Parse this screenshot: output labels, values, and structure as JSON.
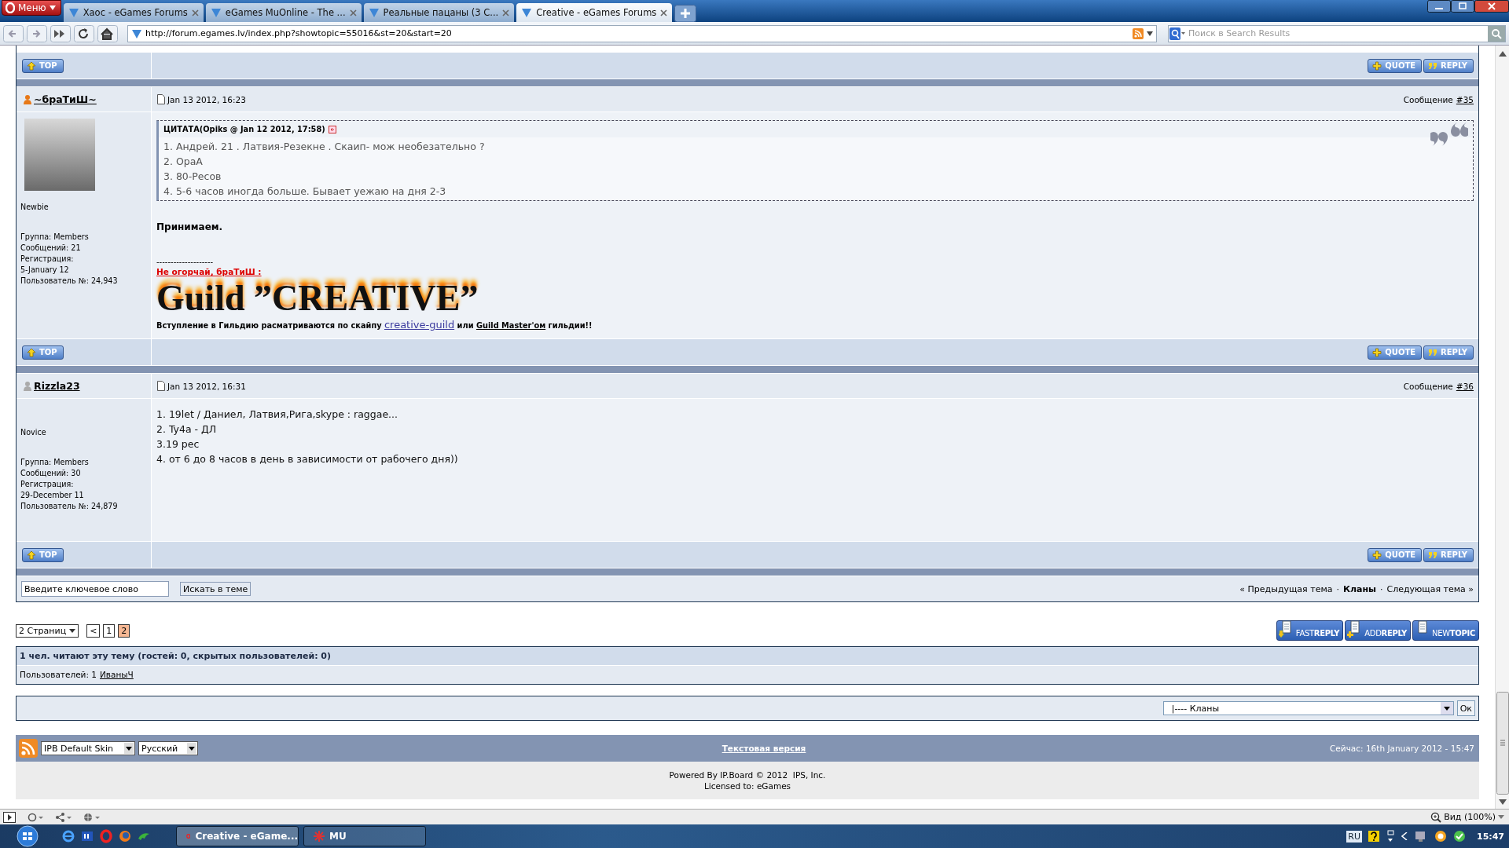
{
  "browser": {
    "menu": "Меню",
    "tabs": [
      {
        "title": "Хаос - eGames Forums",
        "selected": false
      },
      {
        "title": "eGames MuOnline - The ...",
        "selected": false
      },
      {
        "title": "Реальные пацаны (3 С...",
        "selected": false
      },
      {
        "title": "Creative - eGames Forums",
        "selected": true
      }
    ],
    "address": "http://forum.egames.lv/index.php?showtopic=55016&st=20&start=20",
    "search_placeholder": "Поиск в Search Results"
  },
  "lead_bar": {
    "top": "TOP",
    "quote": "QUOTE",
    "reply": "REPLY"
  },
  "posts": [
    {
      "author": "~браТиШ~",
      "online": true,
      "date": "Jan 13 2012, 16:23",
      "number_label": "Сообщение",
      "number": "#35",
      "avatar": true,
      "rank": "Newbie",
      "details": [
        "Группа: Members",
        "Сообщений: 21",
        "Регистрация:",
        "5-January 12",
        "Пользователь №: 24,943"
      ],
      "quote": {
        "header": "ЦИТАТА(Opiks @ Jan 12 2012, 17:58)",
        "lines": [
          "1. Андрей. 21 . Латвия-Резекне . Скаип- мож необезательно ?",
          "2. OpaA",
          "3. 80-Ресов",
          "4. 5-6 часов иногда больше. Бывает уежаю на дня 2-3"
        ]
      },
      "body": [
        {
          "kind": "bold",
          "text": "Принимаем."
        }
      ],
      "signature": {
        "rule": "--------------------",
        "title": "Не огорчай, браТиШ :",
        "banner": "Guild ”CREATIVE”",
        "line": [
          {
            "kind": "text",
            "text": "Вступление в Гильдию расматриваются по скайпу "
          },
          {
            "kind": "skype",
            "text": "creative-guild"
          },
          {
            "kind": "text",
            "text": " или "
          },
          {
            "kind": "link",
            "text": "Guild Master'ом"
          },
          {
            "kind": "text",
            "text": " гильдии!!"
          }
        ]
      },
      "bar": {
        "top": "TOP",
        "quote": "QUOTE",
        "reply": "REPLY"
      }
    },
    {
      "author": "Rizzla23",
      "online": false,
      "date": "Jan 13 2012, 16:31",
      "number_label": "Сообщение",
      "number": "#36",
      "avatar": false,
      "rank": "Novice",
      "details": [
        "Группа: Members",
        "Сообщений: 30",
        "Регистрация:",
        "29-December 11",
        "Пользователь №: 24,879"
      ],
      "body": [
        {
          "kind": "plain",
          "text": "1. 19let / Даниел, Латвия,Рига,skype : raggae..."
        },
        {
          "kind": "plain",
          "text": "2. Ty4a - ДЛ"
        },
        {
          "kind": "plain",
          "text": "3.19 рес"
        },
        {
          "kind": "plain",
          "text": "4. от 6 до 8 часов в день в зависимости от рабочего дня))"
        }
      ],
      "bar": {
        "top": "TOP",
        "quote": "QUOTE",
        "reply": "REPLY"
      }
    }
  ],
  "topic_tools": {
    "search_value": "Введите ключевое слово",
    "search_button": "Искать в теме",
    "nav": [
      {
        "kind": "link",
        "text": "« Предыдущая тема"
      },
      {
        "kind": "separator",
        "text": "·"
      },
      {
        "kind": "current",
        "text": "Кланы"
      },
      {
        "kind": "separator",
        "text": "·"
      },
      {
        "kind": "link",
        "text": "Следующая тема »"
      }
    ]
  },
  "pagination": {
    "pages_menu": "2 Страниц",
    "prev": "<",
    "pages": [
      {
        "label": "1",
        "selected": false
      },
      {
        "label": "2",
        "selected": true
      }
    ]
  },
  "topic_buttons": [
    {
      "kind": "fastreply",
      "label": "FAST**REPLY**"
    },
    {
      "kind": "addreply",
      "label": "ADD**REPLY**"
    },
    {
      "kind": "newtopic",
      "label": "NEW**TOPIC**"
    }
  ],
  "active_users": {
    "title": "1 чел. читают эту тему (гостей: 0, скрытых пользователей: 0)",
    "label": "Пользователей: 1",
    "users": [
      "ИваныЧ"
    ]
  },
  "jump": {
    "value": "|---- Кланы",
    "button": "Ок"
  },
  "footer": {
    "skin": "IPB Default Skin",
    "language": "Русский",
    "text_version": "Текстовая версия",
    "time": "Сейчас: 16th January 2012 - 15:47"
  },
  "copyright": {
    "line1": "Powered By IP.Board © 2012  IPS, Inc.",
    "line2": "Licensed to: eGames"
  },
  "status_bar": {
    "zoom": "Вид (100%)"
  },
  "taskbar": {
    "tasks": [
      {
        "kind": "browser",
        "label": "Creative - eGame...",
        "selected": true
      },
      {
        "kind": "game",
        "label": "MU",
        "selected": false
      }
    ],
    "language": "RU",
    "clock": "15:47"
  }
}
